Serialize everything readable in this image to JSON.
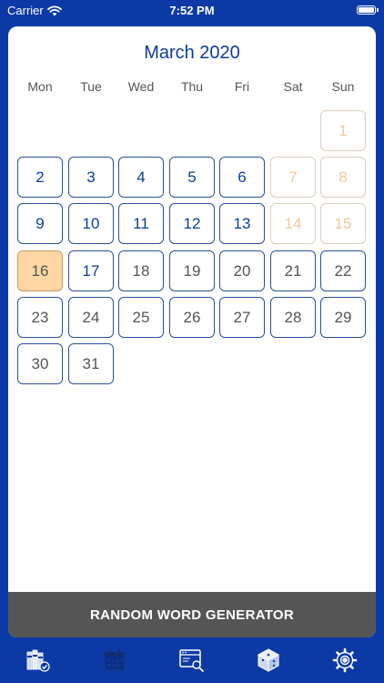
{
  "status_bar": {
    "carrier": "Carrier",
    "time": "7:52 PM"
  },
  "calendar": {
    "month_title": "March 2020",
    "weekdays": [
      "Mon",
      "Tue",
      "Wed",
      "Thu",
      "Fri",
      "Sat",
      "Sun"
    ],
    "first_weekday_index": 6,
    "days": [
      {
        "label": "1",
        "state": "weekend"
      },
      {
        "label": "2",
        "state": "current"
      },
      {
        "label": "3",
        "state": "current"
      },
      {
        "label": "4",
        "state": "current"
      },
      {
        "label": "5",
        "state": "current"
      },
      {
        "label": "6",
        "state": "current"
      },
      {
        "label": "7",
        "state": "weekend"
      },
      {
        "label": "8",
        "state": "weekend"
      },
      {
        "label": "9",
        "state": "current"
      },
      {
        "label": "10",
        "state": "current"
      },
      {
        "label": "11",
        "state": "current"
      },
      {
        "label": "12",
        "state": "current"
      },
      {
        "label": "13",
        "state": "current"
      },
      {
        "label": "14",
        "state": "weekend"
      },
      {
        "label": "15",
        "state": "weekend"
      },
      {
        "label": "16",
        "state": "today"
      },
      {
        "label": "17",
        "state": "current"
      },
      {
        "label": "18",
        "state": "future"
      },
      {
        "label": "19",
        "state": "future"
      },
      {
        "label": "20",
        "state": "future"
      },
      {
        "label": "21",
        "state": "future"
      },
      {
        "label": "22",
        "state": "future"
      },
      {
        "label": "23",
        "state": "future"
      },
      {
        "label": "24",
        "state": "future"
      },
      {
        "label": "25",
        "state": "future"
      },
      {
        "label": "26",
        "state": "future"
      },
      {
        "label": "27",
        "state": "future"
      },
      {
        "label": "28",
        "state": "future"
      },
      {
        "label": "29",
        "state": "future"
      },
      {
        "label": "30",
        "state": "future"
      },
      {
        "label": "31",
        "state": "future"
      }
    ]
  },
  "generator_button": {
    "label": "RANDOM WORD GENERATOR"
  },
  "tab_bar": {
    "items": [
      {
        "icon": "books-icon",
        "active": false
      },
      {
        "icon": "calendar-icon",
        "active": true
      },
      {
        "icon": "browser-search-icon",
        "active": false
      },
      {
        "icon": "cube-icon",
        "active": false
      },
      {
        "icon": "settings-gear-icon",
        "active": false
      }
    ]
  },
  "colors": {
    "background": "#0b3aa6",
    "accent": "#0d3d99",
    "today": "#fdd6a3",
    "weekend_text": "#f2c89a",
    "button": "#555555"
  }
}
